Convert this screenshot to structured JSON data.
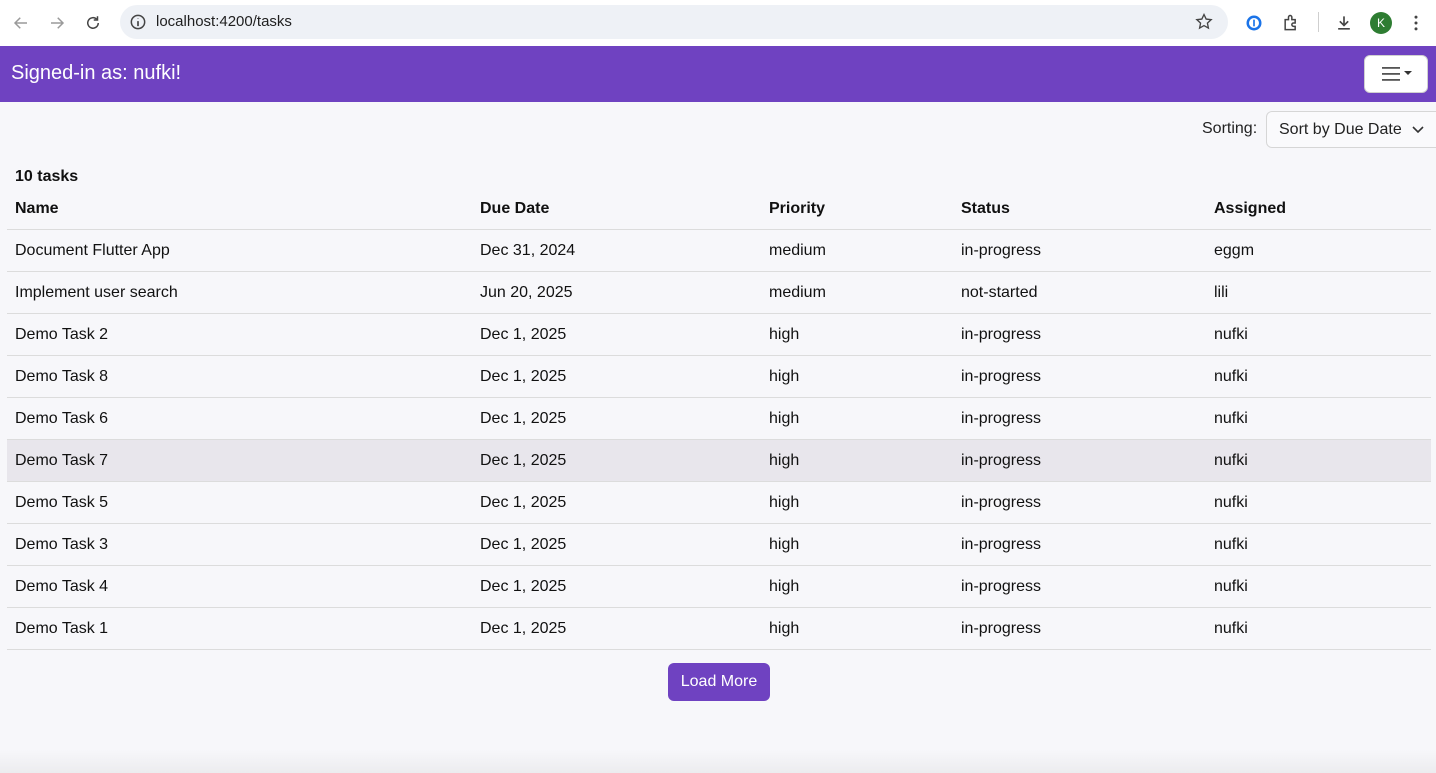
{
  "browser": {
    "url": "localhost:4200/tasks",
    "profile_initial": "K"
  },
  "header": {
    "title": "Signed-in as: nufki!"
  },
  "sorting": {
    "label": "Sorting:",
    "selected": "Sort by Due Date"
  },
  "tasks": {
    "count_label": "10 tasks",
    "columns": [
      "Name",
      "Due Date",
      "Priority",
      "Status",
      "Assigned"
    ],
    "rows": [
      [
        "Document Flutter App",
        "Dec 31, 2024",
        "medium",
        "in-progress",
        "eggm"
      ],
      [
        "Implement user search",
        "Jun 20, 2025",
        "medium",
        "not-started",
        "lili"
      ],
      [
        "Demo Task 2",
        "Dec 1, 2025",
        "high",
        "in-progress",
        "nufki"
      ],
      [
        "Demo Task 8",
        "Dec 1, 2025",
        "high",
        "in-progress",
        "nufki"
      ],
      [
        "Demo Task 6",
        "Dec 1, 2025",
        "high",
        "in-progress",
        "nufki"
      ],
      [
        "Demo Task 7",
        "Dec 1, 2025",
        "high",
        "in-progress",
        "nufki"
      ],
      [
        "Demo Task 5",
        "Dec 1, 2025",
        "high",
        "in-progress",
        "nufki"
      ],
      [
        "Demo Task 3",
        "Dec 1, 2025",
        "high",
        "in-progress",
        "nufki"
      ],
      [
        "Demo Task 4",
        "Dec 1, 2025",
        "high",
        "in-progress",
        "nufki"
      ],
      [
        "Demo Task 1",
        "Dec 1, 2025",
        "high",
        "in-progress",
        "nufki"
      ]
    ],
    "highlighted_row": 5
  },
  "load_more_label": "Load More",
  "colors": {
    "accent": "#6f42c1",
    "profile": "#2e7d32"
  }
}
